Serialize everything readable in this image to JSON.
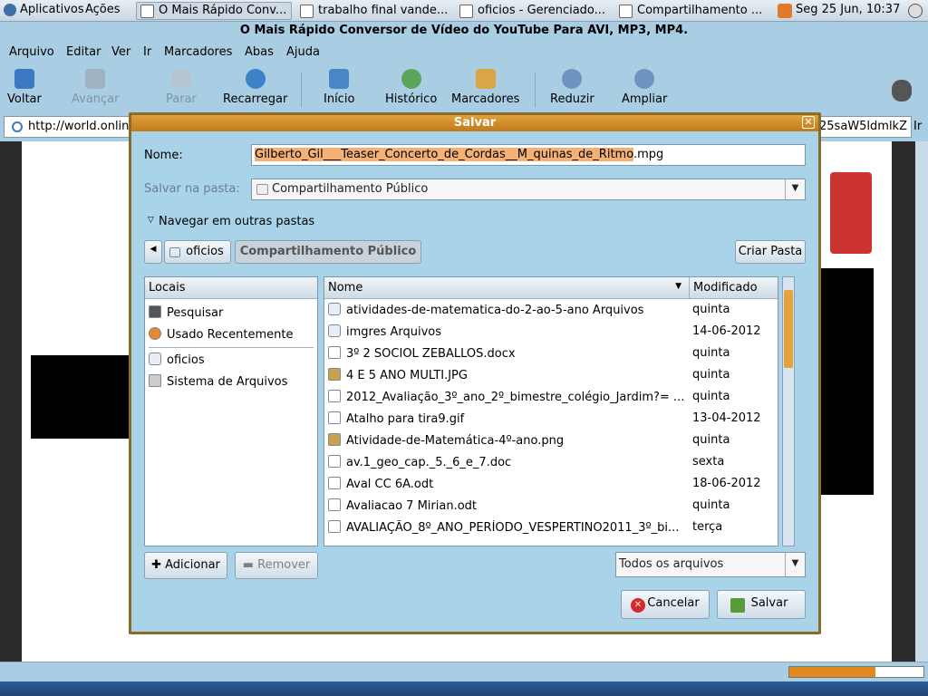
{
  "panel": {
    "apps": "Aplicativos",
    "actions": "Ações",
    "tasks": [
      "O Mais Rápido Conv...",
      "trabalho final vande...",
      "oficios - Gerenciado...",
      "Compartilhamento ..."
    ],
    "clock": "Seg 25 Jun, 10:37"
  },
  "browser": {
    "title": "O Mais Rápido Conversor de Vídeo do YouTube Para AVI, MP3, MP4.",
    "menu": [
      "Arquivo",
      "Editar",
      "Ver",
      "Ir",
      "Marcadores",
      "Abas",
      "Ajuda"
    ],
    "toolbar": {
      "back": "Voltar",
      "forward": "Avançar",
      "stop": "Parar",
      "reload": "Recarregar",
      "home": "Início",
      "history": "Histórico",
      "bookmarks": "Marcadores",
      "zoom_out": "Reduzir",
      "zoom_in": "Ampliar"
    },
    "url": "http://world.online",
    "url_tail": "25saW5ldmlkZ",
    "go": "Ir"
  },
  "dialog": {
    "title": "Salvar",
    "name_label": "Nome:",
    "name_selected": "Gilberto_Gil___Teaser_Concerto_de_Cordas__M_quinas_de_Ritmo",
    "name_ext": ".mpg",
    "folder_label": "Salvar na pasta:",
    "folder_value": "Compartilhamento Público",
    "browse_toggle": "Navegar em outras pastas",
    "path": [
      "oficios",
      "Compartilhamento Público"
    ],
    "create_folder": "Criar Pasta",
    "places_header": "Locais",
    "places": [
      "Pesquisar",
      "Usado Recentemente",
      "oficios",
      "Sistema de Arquivos"
    ],
    "col_name": "Nome",
    "col_modified": "Modificado",
    "files": [
      {
        "name": "atividades-de-matematica-do-2-ao-5-ano Arquivos",
        "modified": "quinta",
        "kind": "folder"
      },
      {
        "name": "imgres Arquivos",
        "modified": "14-06-2012",
        "kind": "folder"
      },
      {
        "name": "3º 2 SOCIOL ZEBALLOS.docx",
        "modified": "quinta",
        "kind": "doc"
      },
      {
        "name": "4 E 5 ANO MULTI.JPG",
        "modified": "quinta",
        "kind": "img"
      },
      {
        "name": "2012_Avaliação_3º_ano_2º_bimestre_colégio_Jardim?= ...",
        "modified": "quinta",
        "kind": "doc"
      },
      {
        "name": "Atalho para tira9.gif",
        "modified": "13-04-2012",
        "kind": "doc"
      },
      {
        "name": "Atividade-de-Matemática-4º-ano.png",
        "modified": "quinta",
        "kind": "img"
      },
      {
        "name": "av.1_geo_cap._5._6_e_7.doc",
        "modified": "sexta",
        "kind": "doc"
      },
      {
        "name": "Aval CC 6A.odt",
        "modified": "18-06-2012",
        "kind": "doc"
      },
      {
        "name": "Avaliacao 7 Mirian.odt",
        "modified": "quinta",
        "kind": "doc"
      },
      {
        "name": "AVALIAÇÃO_8º_ANO_PERÍODO_VESPERTINO2011_3º_bi...",
        "modified": "terça",
        "kind": "doc"
      }
    ],
    "add": "Adicionar",
    "remove": "Remover",
    "filter": "Todos os arquivos",
    "cancel": "Cancelar",
    "save": "Salvar"
  }
}
